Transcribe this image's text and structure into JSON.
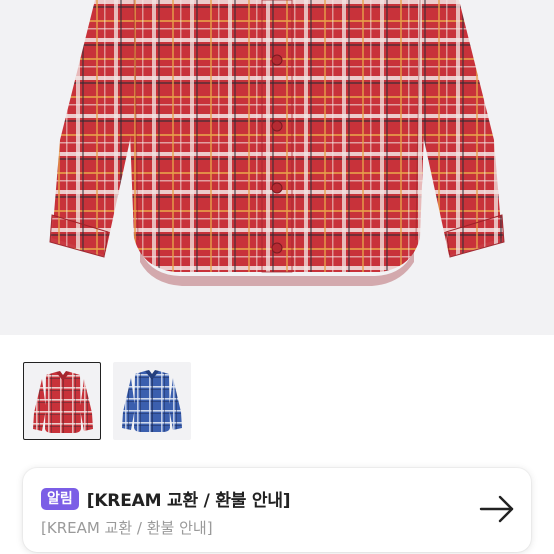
{
  "product": {
    "thumbnails": [
      {
        "color": "red-plaid",
        "selected": true
      },
      {
        "color": "blue-plaid",
        "selected": false
      }
    ]
  },
  "notice": {
    "badge": "알림",
    "title": "[KREAM 교환 / 환불 안내]",
    "subtitle": "[KREAM 교환 / 환불 안내]",
    "icon": "arrow-right-icon"
  },
  "colors": {
    "accent": "#7b5ee6",
    "plaid_red": "#c8323a",
    "plaid_blue": "#3b5fae",
    "background": "#f2f2f4"
  }
}
